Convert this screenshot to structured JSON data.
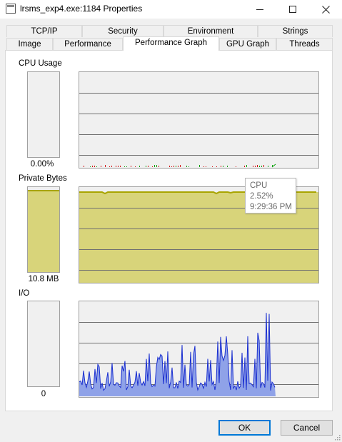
{
  "window": {
    "title": "lrsms_exp4.exe:1184 Properties",
    "controls": {
      "minimize": "—",
      "maximize": "☐",
      "close": "✕"
    }
  },
  "tabs": {
    "row1": [
      "TCP/IP",
      "Security",
      "Environment",
      "Strings"
    ],
    "row2": [
      "Image",
      "Performance",
      "Performance Graph",
      "GPU Graph",
      "Threads"
    ],
    "active": "Performance Graph"
  },
  "sections": {
    "cpu": {
      "label": "CPU Usage",
      "value": "0.00%",
      "level": 0.0
    },
    "private_bytes": {
      "label": "Private Bytes",
      "value": "10.8 MB",
      "level": 0.97
    },
    "io": {
      "label": "I/O",
      "value": "0",
      "level": 0.0
    }
  },
  "tooltip": {
    "title": "CPU",
    "value": "2.52%",
    "time": "9:29:36 PM"
  },
  "buttons": {
    "ok": "OK",
    "cancel": "Cancel"
  },
  "colors": {
    "graph_background": "#f0f0f0",
    "grid_line": "#707070",
    "private_bytes_fill": "#d8d47a",
    "private_bytes_line": "#a8a400",
    "io_fill": "#8fa2e8",
    "io_line": "#1a2fd0",
    "cpu_kernel": "#d00000",
    "cpu_user": "#00a000",
    "accent": "#0078d7"
  }
}
